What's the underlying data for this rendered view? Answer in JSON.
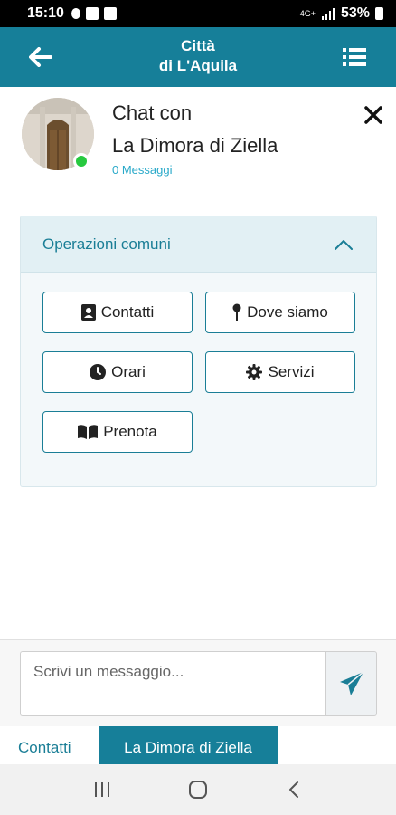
{
  "status_bar": {
    "time": "15:10",
    "network": "4G+",
    "battery": "53%"
  },
  "header": {
    "title_line1": "Città",
    "title_line2": "di L'Aquila"
  },
  "chat_header": {
    "title_line1": "Chat con",
    "title_line2": "La Dimora di Ziella",
    "message_count": "0 Messaggi",
    "status": "online"
  },
  "operations": {
    "title": "Operazioni comuni",
    "buttons": [
      {
        "label": "Contatti",
        "icon": "contact-card-icon"
      },
      {
        "label": "Dove siamo",
        "icon": "map-pin-icon"
      },
      {
        "label": "Orari",
        "icon": "clock-icon"
      },
      {
        "label": "Servizi",
        "icon": "gear-icon"
      },
      {
        "label": "Prenota",
        "icon": "book-icon"
      }
    ]
  },
  "composer": {
    "placeholder": "Scrivi un messaggio...",
    "value": ""
  },
  "bottom_tabs": {
    "tab1": "Contatti",
    "tab2": "La Dimora di Ziella"
  },
  "colors": {
    "primary": "#167f99",
    "accent_text": "#1a7e96",
    "online": "#27c93f",
    "link": "#29a9c9"
  }
}
